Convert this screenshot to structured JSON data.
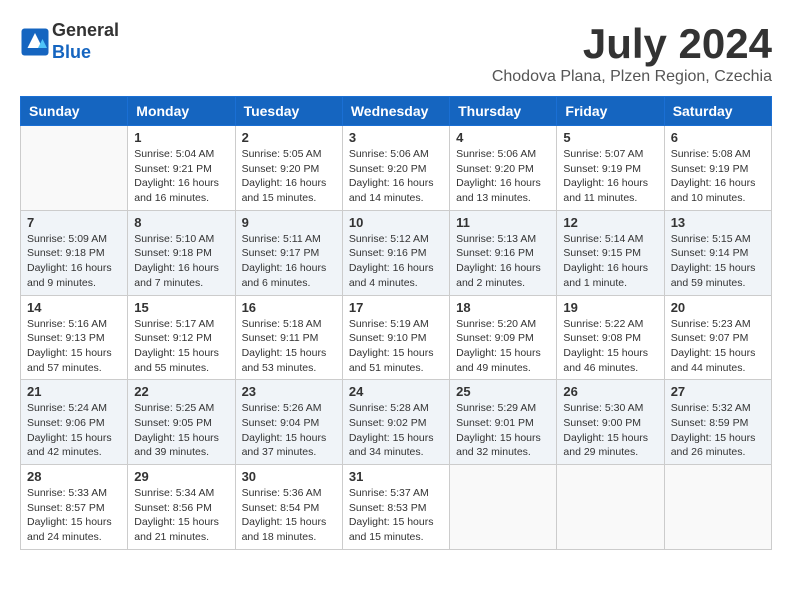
{
  "header": {
    "logo_general": "General",
    "logo_blue": "Blue",
    "month_title": "July 2024",
    "location": "Chodova Plana, Plzen Region, Czechia"
  },
  "weekdays": [
    "Sunday",
    "Monday",
    "Tuesday",
    "Wednesday",
    "Thursday",
    "Friday",
    "Saturday"
  ],
  "weeks": [
    [
      {
        "day": "",
        "info": ""
      },
      {
        "day": "1",
        "info": "Sunrise: 5:04 AM\nSunset: 9:21 PM\nDaylight: 16 hours\nand 16 minutes."
      },
      {
        "day": "2",
        "info": "Sunrise: 5:05 AM\nSunset: 9:20 PM\nDaylight: 16 hours\nand 15 minutes."
      },
      {
        "day": "3",
        "info": "Sunrise: 5:06 AM\nSunset: 9:20 PM\nDaylight: 16 hours\nand 14 minutes."
      },
      {
        "day": "4",
        "info": "Sunrise: 5:06 AM\nSunset: 9:20 PM\nDaylight: 16 hours\nand 13 minutes."
      },
      {
        "day": "5",
        "info": "Sunrise: 5:07 AM\nSunset: 9:19 PM\nDaylight: 16 hours\nand 11 minutes."
      },
      {
        "day": "6",
        "info": "Sunrise: 5:08 AM\nSunset: 9:19 PM\nDaylight: 16 hours\nand 10 minutes."
      }
    ],
    [
      {
        "day": "7",
        "info": "Sunrise: 5:09 AM\nSunset: 9:18 PM\nDaylight: 16 hours\nand 9 minutes."
      },
      {
        "day": "8",
        "info": "Sunrise: 5:10 AM\nSunset: 9:18 PM\nDaylight: 16 hours\nand 7 minutes."
      },
      {
        "day": "9",
        "info": "Sunrise: 5:11 AM\nSunset: 9:17 PM\nDaylight: 16 hours\nand 6 minutes."
      },
      {
        "day": "10",
        "info": "Sunrise: 5:12 AM\nSunset: 9:16 PM\nDaylight: 16 hours\nand 4 minutes."
      },
      {
        "day": "11",
        "info": "Sunrise: 5:13 AM\nSunset: 9:16 PM\nDaylight: 16 hours\nand 2 minutes."
      },
      {
        "day": "12",
        "info": "Sunrise: 5:14 AM\nSunset: 9:15 PM\nDaylight: 16 hours\nand 1 minute."
      },
      {
        "day": "13",
        "info": "Sunrise: 5:15 AM\nSunset: 9:14 PM\nDaylight: 15 hours\nand 59 minutes."
      }
    ],
    [
      {
        "day": "14",
        "info": "Sunrise: 5:16 AM\nSunset: 9:13 PM\nDaylight: 15 hours\nand 57 minutes."
      },
      {
        "day": "15",
        "info": "Sunrise: 5:17 AM\nSunset: 9:12 PM\nDaylight: 15 hours\nand 55 minutes."
      },
      {
        "day": "16",
        "info": "Sunrise: 5:18 AM\nSunset: 9:11 PM\nDaylight: 15 hours\nand 53 minutes."
      },
      {
        "day": "17",
        "info": "Sunrise: 5:19 AM\nSunset: 9:10 PM\nDaylight: 15 hours\nand 51 minutes."
      },
      {
        "day": "18",
        "info": "Sunrise: 5:20 AM\nSunset: 9:09 PM\nDaylight: 15 hours\nand 49 minutes."
      },
      {
        "day": "19",
        "info": "Sunrise: 5:22 AM\nSunset: 9:08 PM\nDaylight: 15 hours\nand 46 minutes."
      },
      {
        "day": "20",
        "info": "Sunrise: 5:23 AM\nSunset: 9:07 PM\nDaylight: 15 hours\nand 44 minutes."
      }
    ],
    [
      {
        "day": "21",
        "info": "Sunrise: 5:24 AM\nSunset: 9:06 PM\nDaylight: 15 hours\nand 42 minutes."
      },
      {
        "day": "22",
        "info": "Sunrise: 5:25 AM\nSunset: 9:05 PM\nDaylight: 15 hours\nand 39 minutes."
      },
      {
        "day": "23",
        "info": "Sunrise: 5:26 AM\nSunset: 9:04 PM\nDaylight: 15 hours\nand 37 minutes."
      },
      {
        "day": "24",
        "info": "Sunrise: 5:28 AM\nSunset: 9:02 PM\nDaylight: 15 hours\nand 34 minutes."
      },
      {
        "day": "25",
        "info": "Sunrise: 5:29 AM\nSunset: 9:01 PM\nDaylight: 15 hours\nand 32 minutes."
      },
      {
        "day": "26",
        "info": "Sunrise: 5:30 AM\nSunset: 9:00 PM\nDaylight: 15 hours\nand 29 minutes."
      },
      {
        "day": "27",
        "info": "Sunrise: 5:32 AM\nSunset: 8:59 PM\nDaylight: 15 hours\nand 26 minutes."
      }
    ],
    [
      {
        "day": "28",
        "info": "Sunrise: 5:33 AM\nSunset: 8:57 PM\nDaylight: 15 hours\nand 24 minutes."
      },
      {
        "day": "29",
        "info": "Sunrise: 5:34 AM\nSunset: 8:56 PM\nDaylight: 15 hours\nand 21 minutes."
      },
      {
        "day": "30",
        "info": "Sunrise: 5:36 AM\nSunset: 8:54 PM\nDaylight: 15 hours\nand 18 minutes."
      },
      {
        "day": "31",
        "info": "Sunrise: 5:37 AM\nSunset: 8:53 PM\nDaylight: 15 hours\nand 15 minutes."
      },
      {
        "day": "",
        "info": ""
      },
      {
        "day": "",
        "info": ""
      },
      {
        "day": "",
        "info": ""
      }
    ]
  ]
}
